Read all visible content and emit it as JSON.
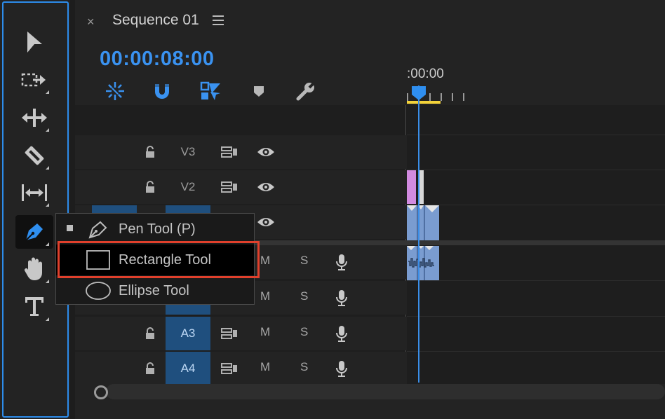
{
  "tools_panel": {
    "tools": [
      {
        "icon": "selection-arrow-icon",
        "has_submenu": false
      },
      {
        "icon": "track-select-forward-icon",
        "has_submenu": true
      },
      {
        "icon": "ripple-edit-icon",
        "has_submenu": true
      },
      {
        "icon": "razor-icon",
        "has_submenu": true
      },
      {
        "icon": "slip-icon",
        "has_submenu": true
      },
      {
        "icon": "pen-icon",
        "has_submenu": true,
        "active": true
      },
      {
        "icon": "hand-icon",
        "has_submenu": true
      },
      {
        "icon": "type-icon",
        "has_submenu": true
      }
    ]
  },
  "timeline": {
    "tab_close": "×",
    "tab_title": "Sequence 01",
    "timecode": "00:00:08:00",
    "ruler_label": ":00:00",
    "toolbar_icons": [
      "nest-sequences-icon",
      "snap-magnet-icon",
      "linked-selection-icon",
      "add-marker-icon",
      "timeline-settings-wrench-icon"
    ],
    "video_tracks": [
      {
        "name": "V3"
      },
      {
        "name": "V2"
      }
    ],
    "audio_tracks": [
      {
        "name": "A3",
        "m": "M",
        "s": "S"
      },
      {
        "name": "A4",
        "m": "M",
        "s": "S"
      }
    ],
    "hidden_row_labels": {
      "m": "M",
      "s": "S"
    }
  },
  "flyout": {
    "items": [
      {
        "label": "Pen Tool (P)",
        "icon": "pen-icon",
        "selected": true
      },
      {
        "label": "Rectangle Tool",
        "icon": "rectangle-icon",
        "highlighted": true
      },
      {
        "label": "Ellipse Tool",
        "icon": "ellipse-icon"
      }
    ]
  },
  "colors": {
    "accent": "#3a92f0",
    "highlight_border": "#e0402c",
    "work_area": "#f2d23a",
    "clip_video": "#7a9cd0",
    "clip_graphic": "#d28be0"
  }
}
